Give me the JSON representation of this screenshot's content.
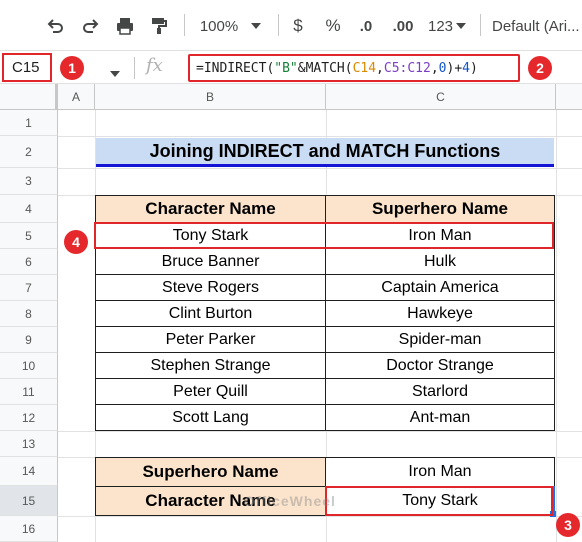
{
  "toolbar": {
    "zoom": "100%",
    "currency": "$",
    "percent": "%",
    "decrease_decimal": ".0",
    "increase_decimal": ".00",
    "number_format": "123",
    "font": "Default (Ari..."
  },
  "formula_bar": {
    "cell_ref": "C15",
    "fx": "fx",
    "formula_parts": [
      "=INDIRECT(",
      "\"B\"",
      "&MATCH(",
      "C14",
      ",",
      "C5:C12",
      ",",
      "0",
      ")+",
      "4",
      ")"
    ]
  },
  "badges": [
    "1",
    "2",
    "3",
    "4"
  ],
  "columns": [
    "A",
    "B",
    "C"
  ],
  "rows": [
    "1",
    "2",
    "3",
    "4",
    "5",
    "6",
    "7",
    "8",
    "9",
    "10",
    "11",
    "12",
    "13",
    "14",
    "15",
    "16"
  ],
  "title": "Joining INDIRECT and MATCH Functions",
  "table": {
    "headers": [
      "Character Name",
      "Superhero Name"
    ],
    "rows": [
      [
        "Tony Stark",
        "Iron Man"
      ],
      [
        "Bruce Banner",
        "Hulk"
      ],
      [
        "Steve Rogers",
        "Captain America"
      ],
      [
        "Clint Burton",
        "Hawkeye"
      ],
      [
        "Peter Parker",
        "Spider-man"
      ],
      [
        "Stephen Strange",
        "Doctor Strange"
      ],
      [
        "Peter Quill",
        "Starlord"
      ],
      [
        "Scott Lang",
        "Ant-man"
      ]
    ]
  },
  "lookup": {
    "label1": "Superhero Name",
    "value1": "Iron Man",
    "label2": "Character Name",
    "value2": "Tony Stark"
  },
  "watermark": "OfficeWheel",
  "colors": {
    "accent_red": "#e5282c",
    "header_fill": "#fce4cc",
    "title_fill": "#c9dcf3",
    "formula_orange": "#d98a00",
    "formula_green": "#188038",
    "formula_number": "#1155cc"
  }
}
